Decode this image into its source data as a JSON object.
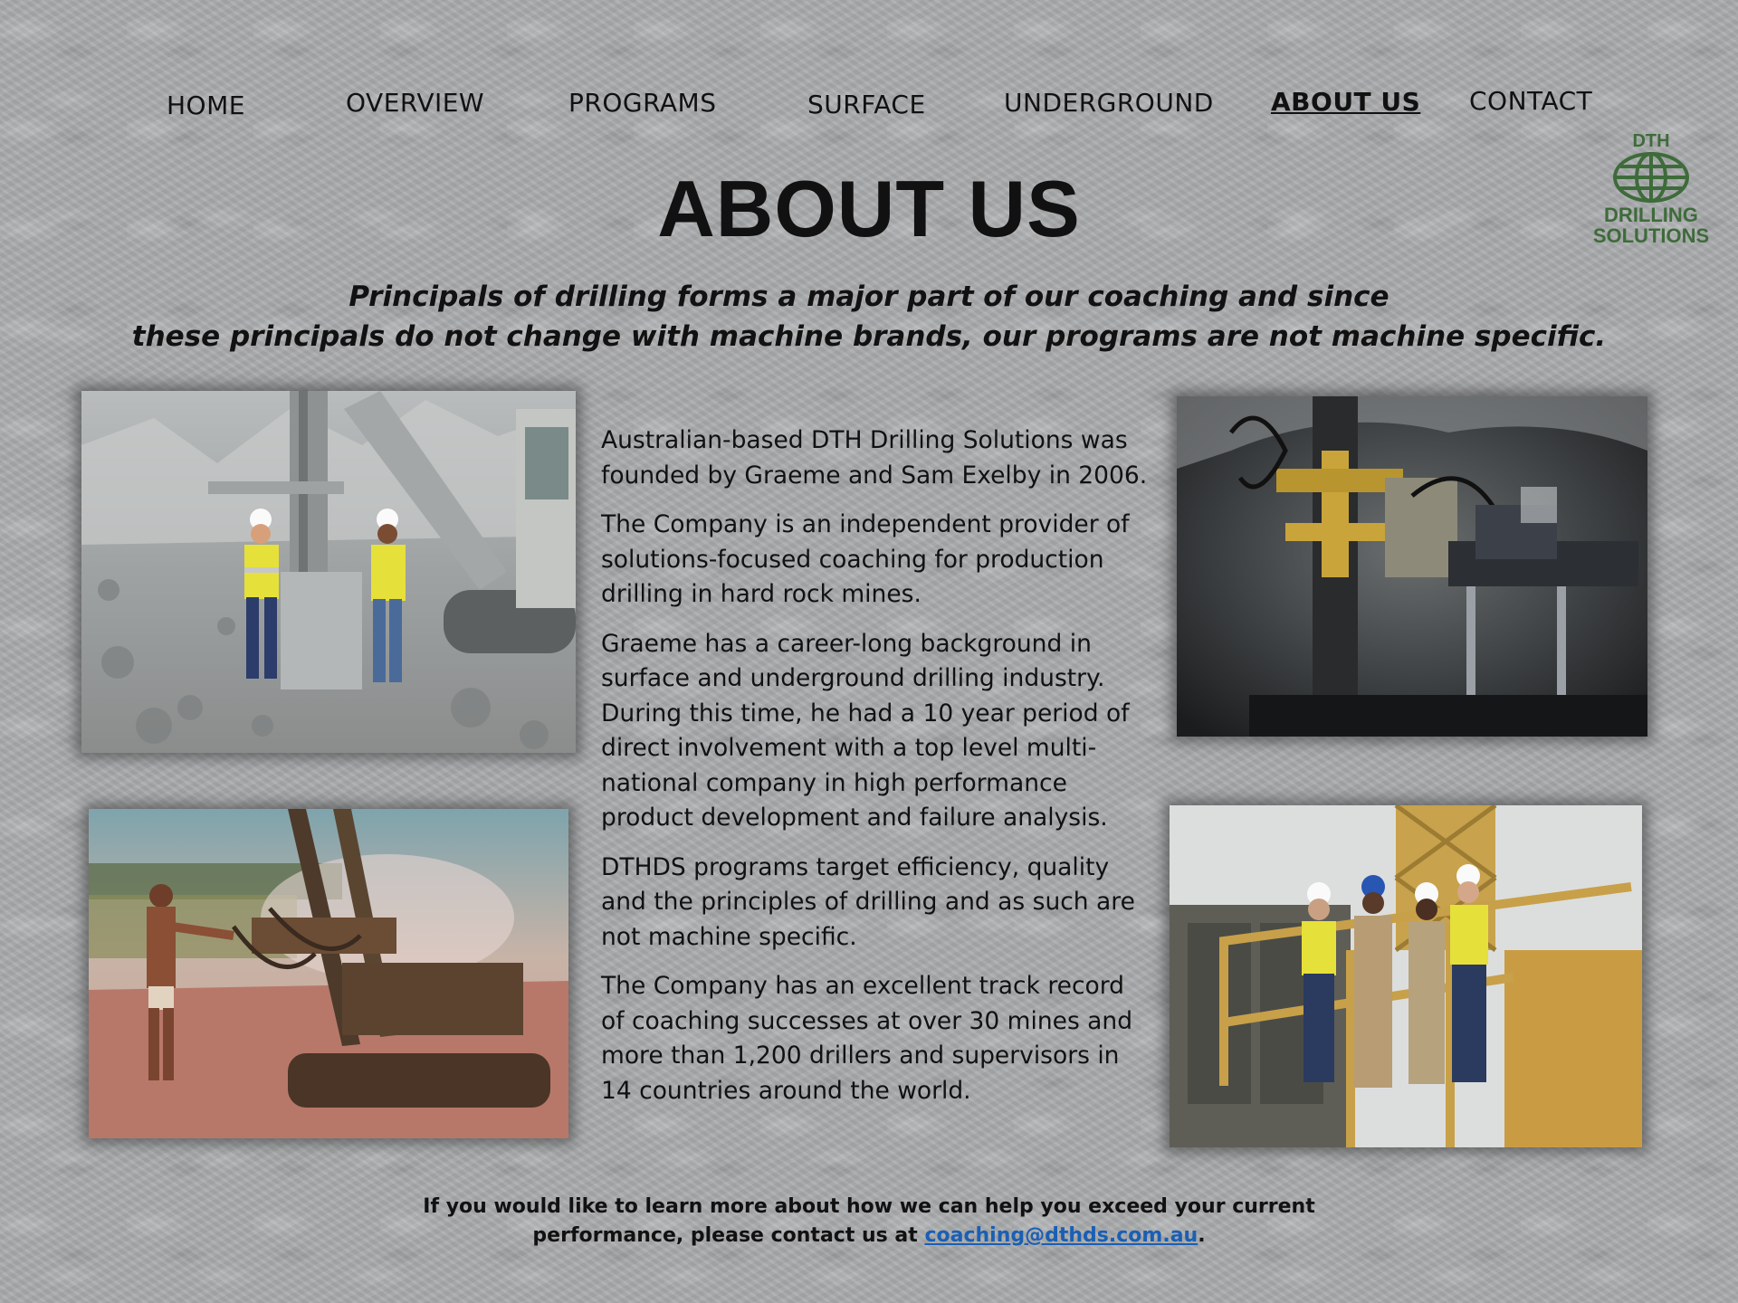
{
  "nav": {
    "home": "HOME",
    "overview": "OVERVIEW",
    "programs": "PROGRAMS",
    "surface": "SURFACE",
    "underground": "UNDERGROUND",
    "about": "ABOUT US",
    "contact": "CONTACT"
  },
  "logo": {
    "top_text": "DTH",
    "line1": "DRILLING",
    "line2": "SOLUTIONS",
    "icon": "globe-icon",
    "color": "#3e6b3a"
  },
  "page": {
    "title": "ABOUT US",
    "tagline_1": "Principals of drilling forms a major part of our coaching and since",
    "tagline_2": "these principals do not change with machine brands, our programs are not machine specific."
  },
  "body": {
    "paragraphs": [
      "Australian-based DTH Drilling Solutions was founded by Graeme and Sam Exelby in 2006.",
      "The Company is an independent provider of solutions-focused coaching for production drilling in hard rock mines.",
      "Graeme has a career-long background in surface and underground drilling industry. During this time, he had a 10 year period of direct involvement with a top level multi-national company in high performance product development and failure analysis.",
      "DTHDS programs target efficiency, quality and the principles of drilling and as such are not machine specific.",
      "The Company has an excellent track record of coaching successes at over 30 mines and more than 1,200 drillers and supervisors in 14 countries around the world."
    ]
  },
  "footer": {
    "line_1": "If you would like to learn more about how we can help you exceed your current",
    "line_2_prefix": "performance, please contact us at",
    "email": "coaching@dthds.com.au",
    "line_2_suffix": "."
  },
  "colors": {
    "link": "#1a5fb4",
    "hi_vis_yellow": "#e6e03a"
  }
}
